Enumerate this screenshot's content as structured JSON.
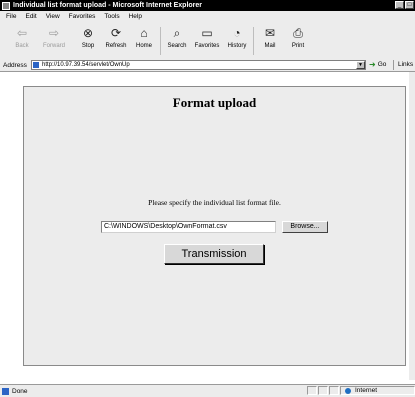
{
  "window": {
    "title": "Individual list format upload - Microsoft Internet Explorer",
    "minimize_glyph": "_",
    "maximize_glyph": "□"
  },
  "menu": [
    "File",
    "Edit",
    "View",
    "Favorites",
    "Tools",
    "Help"
  ],
  "toolbar": {
    "back": {
      "label": "Back",
      "icon": "back-arrow-icon"
    },
    "forward": {
      "label": "Forward",
      "icon": "forward-arrow-icon"
    },
    "stop": {
      "label": "Stop",
      "icon": "stop-icon"
    },
    "refresh": {
      "label": "Refresh",
      "icon": "refresh-icon"
    },
    "home": {
      "label": "Home",
      "icon": "home-icon"
    },
    "search": {
      "label": "Search",
      "icon": "search-icon"
    },
    "favorites": {
      "label": "Favorites",
      "icon": "favorites-icon"
    },
    "history": {
      "label": "History",
      "icon": "history-icon"
    },
    "mail": {
      "label": "Mail",
      "icon": "mail-icon"
    },
    "print": {
      "label": "Print",
      "icon": "print-icon"
    }
  },
  "address": {
    "label": "Address",
    "url": "http://10.97.39.54/servlet/OwnUp",
    "go_label": "Go",
    "links_label": "Links"
  },
  "page": {
    "heading": "Format upload",
    "prompt": "Please specify the individual list format file.",
    "file_value": "C:\\WINDOWS\\Desktop\\OwnFormat.csv",
    "browse_label": "Browse...",
    "transmit_label": "Transmission"
  },
  "status": {
    "text": "Done",
    "zone": "Internet"
  }
}
